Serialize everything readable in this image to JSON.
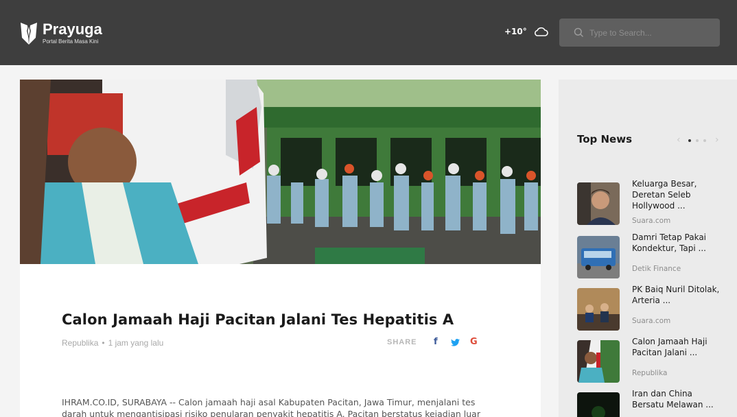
{
  "header": {
    "logo_title": "Prayuga",
    "logo_subtitle": "Portal Berita Masa Kini",
    "temperature": "+10°",
    "weather_icon": "cloud-icon",
    "search_placeholder": "Type to Search..."
  },
  "article": {
    "title": "Calon Jamaah Haji Pacitan Jalani Tes Hepatitis A",
    "source": "Republika",
    "dot": "•",
    "time": "1 jam yang lalu",
    "share_label": "SHARE",
    "share_icons": {
      "facebook": "f",
      "twitter": "t",
      "google": "G"
    },
    "body": "IHRAM.CO.ID, SURABAYA -- Calon jamaah haji asal Kabupaten Pacitan, Jawa Timur, menjalani tes darah untuk mengantisipasi risiko penularan penyakit hepatitis A. Pacitan berstatus kejadian luar"
  },
  "sidebar": {
    "title": "Top News",
    "prev_icon": "‹",
    "next_icon": "›",
    "active_dot": 0,
    "items": [
      {
        "title": "Keluarga Besar, Deretan Seleb Hollywood ...",
        "source": "Suara.com"
      },
      {
        "title": "Damri Tetap Pakai Kondektur, Tapi ...",
        "source": "Detik Finance"
      },
      {
        "title": "PK Baiq Nuril Ditolak, Arteria ...",
        "source": "Suara.com"
      },
      {
        "title": "Calon Jamaah Haji Pacitan Jalani ...",
        "source": "Republika"
      },
      {
        "title": "Iran dan China Bersatu Melawan ...",
        "source": ""
      }
    ]
  },
  "colors": {
    "header_bg": "#3e3e3e",
    "search_bg": "#5f5f5f",
    "facebook": "#3b5998",
    "twitter": "#1da1f2",
    "google": "#dd4b39"
  }
}
